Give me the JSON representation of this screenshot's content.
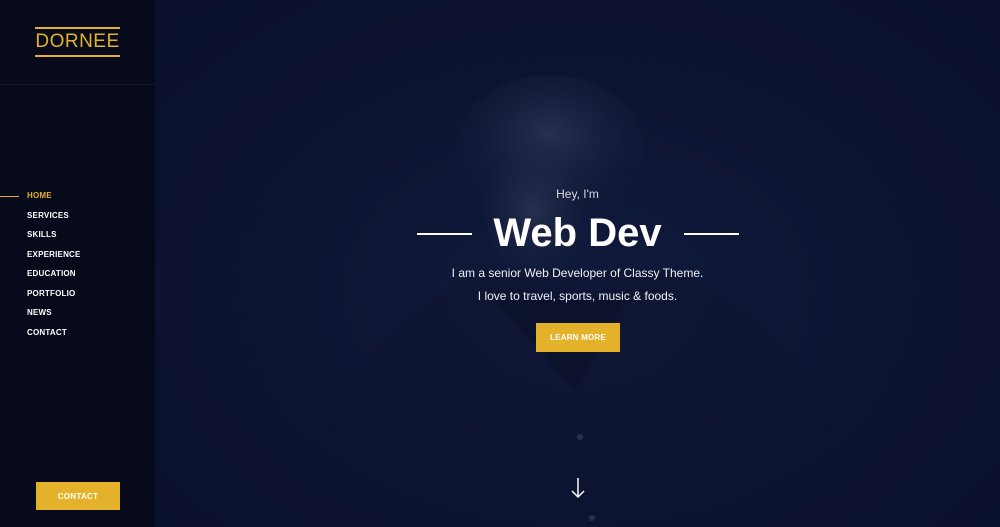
{
  "sidebar": {
    "logo": "DORNEE",
    "nav": [
      {
        "label": "HOME",
        "active": true
      },
      {
        "label": "SERVICES",
        "active": false
      },
      {
        "label": "SKILLS",
        "active": false
      },
      {
        "label": "EXPERIENCE",
        "active": false
      },
      {
        "label": "EDUCATION",
        "active": false
      },
      {
        "label": "PORTFOLIO",
        "active": false
      },
      {
        "label": "NEWS",
        "active": false
      },
      {
        "label": "CONTACT",
        "active": false
      }
    ],
    "contact_button": "CONTACT"
  },
  "hero": {
    "greeting": "Hey, I'm",
    "title": "Web Dev",
    "tagline_line1": "I am a senior Web Developer of Classy Theme.",
    "tagline_line2": "I love to travel, sports, music & foods.",
    "cta_button": "LEARN MORE",
    "scroll_icon": "arrow-down-icon"
  },
  "colors": {
    "accent": "#e3b22a",
    "sidebar_bg": "#070a1b",
    "hero_bg": "#0d1330",
    "text": "#ffffff"
  }
}
